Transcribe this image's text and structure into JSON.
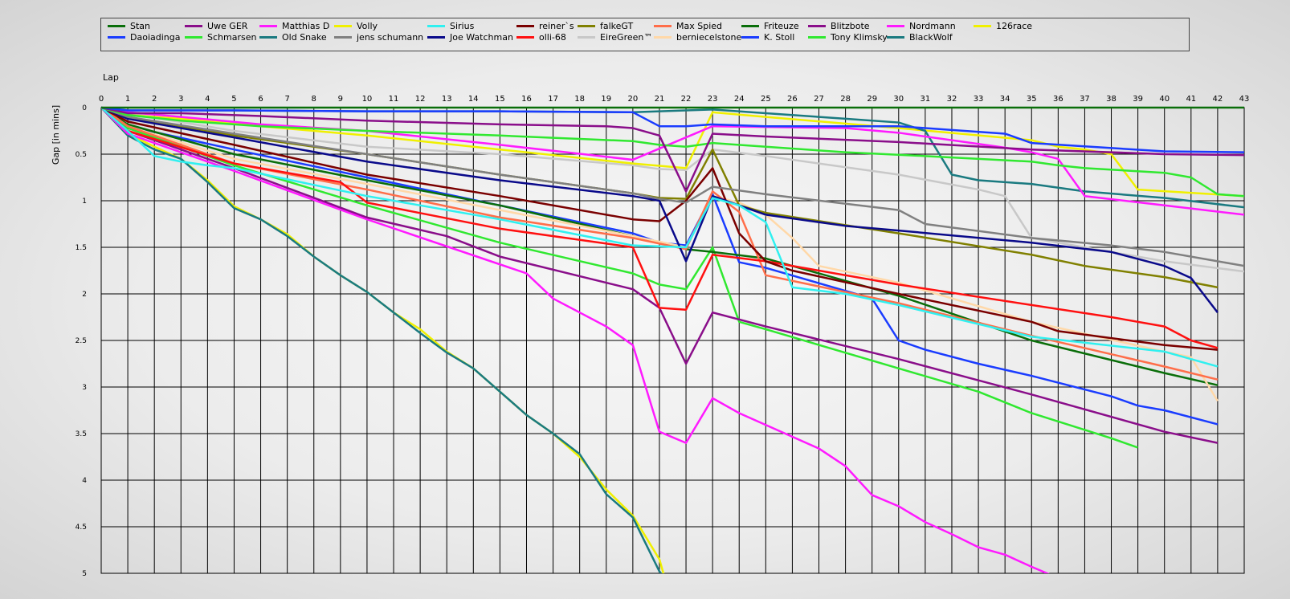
{
  "chart_data": {
    "type": "line",
    "xlabel": "Lap",
    "ylabel": "Gap [in mins]",
    "xlim": [
      0,
      43
    ],
    "ylim": [
      0,
      5
    ],
    "y_inverted": true,
    "x_ticks": [
      0,
      1,
      2,
      3,
      4,
      5,
      6,
      7,
      8,
      9,
      10,
      11,
      12,
      13,
      14,
      15,
      16,
      17,
      18,
      19,
      20,
      21,
      22,
      23,
      24,
      25,
      26,
      27,
      28,
      29,
      30,
      31,
      32,
      33,
      34,
      35,
      36,
      37,
      38,
      39,
      40,
      41,
      42,
      43
    ],
    "y_ticks": [
      "0",
      "0.5",
      "1",
      "1.5",
      "2",
      "2.5",
      "3",
      "3.5",
      "4",
      "4.5",
      "5"
    ],
    "grid": true,
    "legend_position": "top",
    "series": [
      {
        "name": "Stan",
        "color": "#0a6e0a",
        "x": [
          0,
          43
        ],
        "y": [
          0,
          0
        ]
      },
      {
        "name": "Daoiadinga",
        "color": "#1a3cff",
        "x": [
          0,
          1,
          5,
          10,
          15,
          20,
          21,
          22,
          23,
          25,
          30,
          32,
          34,
          35,
          40,
          43
        ],
        "y": [
          0,
          0.03,
          0.03,
          0.04,
          0.04,
          0.05,
          0.2,
          0.2,
          0.18,
          0.2,
          0.2,
          0.24,
          0.28,
          0.38,
          0.47,
          0.48
        ]
      },
      {
        "name": "Uwe GER",
        "color": "#8a0e8a",
        "x": [
          0,
          1,
          3,
          6,
          10,
          15,
          19,
          20,
          21,
          22,
          23,
          25,
          30,
          35,
          40,
          43
        ],
        "y": [
          0,
          0.06,
          0.06,
          0.09,
          0.14,
          0.18,
          0.2,
          0.22,
          0.3,
          0.9,
          0.28,
          0.31,
          0.37,
          0.45,
          0.5,
          0.51
        ]
      },
      {
        "name": "Schmarsen",
        "color": "#30e830",
        "x": [
          0,
          1,
          3,
          6,
          10,
          15,
          20,
          21,
          22,
          23,
          25,
          28,
          31,
          35,
          36,
          37,
          40,
          41,
          42,
          43
        ],
        "y": [
          0,
          0.08,
          0.14,
          0.2,
          0.25,
          0.3,
          0.36,
          0.4,
          0.42,
          0.38,
          0.42,
          0.48,
          0.52,
          0.58,
          0.62,
          0.65,
          0.7,
          0.75,
          0.93,
          0.95
        ]
      },
      {
        "name": "Matthias D",
        "color": "#ff1aff",
        "x": [
          0,
          1,
          3,
          6,
          10,
          15,
          20,
          23,
          28,
          30,
          34,
          35,
          36,
          37,
          40,
          43
        ],
        "y": [
          0,
          0.05,
          0.1,
          0.18,
          0.25,
          0.4,
          0.56,
          0.2,
          0.22,
          0.27,
          0.43,
          0.48,
          0.55,
          0.95,
          1.05,
          1.15
        ]
      },
      {
        "name": "Old Snake",
        "color": "#1a7a80",
        "x": [
          0,
          1,
          5,
          10,
          15,
          20,
          23,
          25,
          28,
          30,
          31,
          32,
          33,
          35,
          37,
          40,
          43
        ],
        "y": [
          0,
          0.03,
          0.03,
          0.04,
          0.04,
          0.05,
          0.02,
          0.06,
          0.12,
          0.16,
          0.25,
          0.72,
          0.78,
          0.82,
          0.9,
          0.97,
          1.07
        ]
      },
      {
        "name": "Volly",
        "color": "#f0f000",
        "x": [
          0,
          1,
          3,
          6,
          10,
          15,
          20,
          22,
          23,
          25,
          30,
          35,
          36,
          37,
          38,
          39,
          43
        ],
        "y": [
          0,
          0.08,
          0.12,
          0.2,
          0.3,
          0.45,
          0.6,
          0.65,
          0.05,
          0.1,
          0.22,
          0.35,
          0.42,
          0.45,
          0.5,
          0.88,
          0.95
        ]
      },
      {
        "name": "jens  schumann",
        "color": "#808080",
        "x": [
          0,
          1,
          5,
          10,
          15,
          20,
          21,
          22,
          23,
          25,
          30,
          31,
          35,
          38,
          40,
          42,
          43
        ],
        "y": [
          0,
          0.1,
          0.28,
          0.5,
          0.72,
          0.92,
          0.98,
          1.02,
          0.85,
          0.93,
          1.1,
          1.25,
          1.4,
          1.48,
          1.55,
          1.65,
          1.7
        ]
      },
      {
        "name": "Sirius",
        "color": "#30f0f0",
        "x": [
          0,
          1,
          2,
          3,
          4,
          5,
          10,
          15,
          20,
          22,
          23,
          24,
          25,
          26,
          28,
          30,
          35,
          40,
          42
        ],
        "y": [
          0,
          0.25,
          0.52,
          0.58,
          0.62,
          0.65,
          0.95,
          1.2,
          1.48,
          1.5,
          0.97,
          1.05,
          1.23,
          1.93,
          2.0,
          2.12,
          2.46,
          2.62,
          2.78
        ]
      },
      {
        "name": "Joe Watchman",
        "color": "#0a0a8a",
        "x": [
          0,
          1,
          5,
          10,
          15,
          20,
          21,
          22,
          23,
          25,
          28,
          30,
          35,
          38,
          40,
          41,
          42
        ],
        "y": [
          0,
          0.12,
          0.32,
          0.58,
          0.78,
          0.95,
          1.0,
          1.65,
          0.95,
          1.15,
          1.27,
          1.32,
          1.45,
          1.55,
          1.7,
          1.83,
          2.2
        ]
      },
      {
        "name": "reiner`s",
        "color": "#7a0000",
        "x": [
          0,
          1,
          5,
          10,
          15,
          20,
          21,
          22,
          23,
          24,
          25,
          26,
          30,
          35,
          36,
          40,
          42
        ],
        "y": [
          0,
          0.15,
          0.4,
          0.72,
          0.95,
          1.2,
          1.22,
          1.0,
          0.65,
          1.35,
          1.65,
          1.75,
          2.0,
          2.3,
          2.4,
          2.55,
          2.6
        ]
      },
      {
        "name": "olli-68",
        "color": "#ff1010",
        "x": [
          0,
          1,
          5,
          9,
          10,
          15,
          20,
          21,
          22,
          23,
          25,
          30,
          35,
          38,
          40,
          41,
          42
        ],
        "y": [
          0,
          0.25,
          0.6,
          0.8,
          1.02,
          1.3,
          1.5,
          2.15,
          2.17,
          1.58,
          1.65,
          1.9,
          2.12,
          2.25,
          2.35,
          2.5,
          2.58
        ]
      },
      {
        "name": "falkeGT",
        "color": "#808000",
        "x": [
          0,
          1,
          5,
          10,
          15,
          20,
          21,
          22,
          23,
          24,
          25,
          30,
          35,
          37,
          40,
          42
        ],
        "y": [
          0,
          0.1,
          0.3,
          0.5,
          0.72,
          0.92,
          0.97,
          0.98,
          0.45,
          1.05,
          1.13,
          1.35,
          1.58,
          1.7,
          1.82,
          1.93
        ]
      },
      {
        "name": "EireGreen™",
        "color": "#c8c8c8",
        "x": [
          0,
          1,
          5,
          10,
          15,
          20,
          21,
          22,
          23,
          25,
          30,
          33,
          34,
          35,
          40,
          43
        ],
        "y": [
          0,
          0.06,
          0.25,
          0.42,
          0.5,
          0.62,
          0.66,
          0.67,
          0.45,
          0.52,
          0.72,
          0.88,
          0.95,
          1.4,
          1.65,
          1.76
        ]
      },
      {
        "name": "Max Spied",
        "color": "#ff6e4a",
        "x": [
          0,
          1,
          5,
          10,
          15,
          20,
          22,
          23,
          24,
          25,
          30,
          35,
          40,
          42
        ],
        "y": [
          0,
          0.2,
          0.6,
          0.88,
          1.18,
          1.4,
          1.52,
          0.9,
          1.12,
          1.8,
          2.1,
          2.45,
          2.78,
          2.92
        ]
      },
      {
        "name": "berniecelstone",
        "color": "#ffd8a8",
        "x": [
          0,
          1,
          5,
          10,
          15,
          20,
          22,
          23,
          24,
          25,
          26,
          27,
          30,
          35,
          40,
          41,
          42
        ],
        "y": [
          0,
          0.2,
          0.55,
          0.82,
          1.1,
          1.38,
          1.5,
          0.95,
          1.02,
          1.15,
          1.4,
          1.7,
          1.88,
          2.3,
          2.62,
          2.68,
          3.15
        ]
      },
      {
        "name": "Friteuze",
        "color": "#0a6e0a",
        "x": [
          0,
          1,
          5,
          10,
          15,
          20,
          22,
          23,
          25,
          30,
          35,
          40,
          42
        ],
        "y": [
          0,
          0.18,
          0.5,
          0.78,
          1.05,
          1.38,
          1.52,
          1.55,
          1.62,
          2.02,
          2.5,
          2.85,
          2.98
        ]
      },
      {
        "name": "K. Stoll",
        "color": "#1a3cff",
        "x": [
          0,
          1,
          5,
          10,
          15,
          20,
          21,
          22,
          23,
          24,
          25,
          29,
          30,
          31,
          33,
          35,
          38,
          39,
          40,
          42
        ],
        "y": [
          0,
          0.2,
          0.45,
          0.75,
          1.05,
          1.35,
          1.45,
          1.48,
          0.93,
          1.66,
          1.72,
          2.05,
          2.5,
          2.6,
          2.75,
          2.88,
          3.1,
          3.2,
          3.25,
          3.4
        ]
      },
      {
        "name": "Blitzbote",
        "color": "#8a0e8a",
        "x": [
          0,
          1,
          5,
          10,
          13,
          15,
          20,
          21,
          22,
          23,
          25,
          30,
          35,
          40,
          42
        ],
        "y": [
          0,
          0.25,
          0.65,
          1.18,
          1.38,
          1.6,
          1.95,
          2.15,
          2.75,
          2.2,
          2.35,
          2.7,
          3.08,
          3.48,
          3.6
        ]
      },
      {
        "name": "Tony Klimsky",
        "color": "#30e830",
        "x": [
          0,
          1,
          5,
          10,
          15,
          20,
          21,
          22,
          23,
          24,
          25,
          30,
          33,
          35,
          38,
          39
        ],
        "y": [
          0,
          0.22,
          0.62,
          1.05,
          1.45,
          1.78,
          1.9,
          1.95,
          1.5,
          2.3,
          2.38,
          2.8,
          3.05,
          3.28,
          3.55,
          3.65
        ]
      },
      {
        "name": "Nordmann",
        "color": "#ff1aff",
        "x": [
          0,
          1,
          5,
          10,
          16,
          17,
          18,
          19,
          20,
          21,
          22,
          23,
          24,
          27,
          28,
          29,
          30,
          31,
          32,
          33,
          34,
          35,
          36,
          36.6
        ],
        "y": [
          0,
          0.28,
          0.68,
          1.2,
          1.78,
          2.05,
          2.2,
          2.35,
          2.55,
          3.48,
          3.6,
          3.12,
          3.28,
          3.66,
          3.85,
          4.16,
          4.28,
          4.45,
          4.58,
          4.72,
          4.8,
          4.93,
          5.05,
          5.1
        ]
      },
      {
        "name": "BlackWolf",
        "color": "#1a7a80",
        "x": [
          0,
          1,
          2,
          3,
          4,
          5,
          6,
          7,
          8,
          9,
          10,
          11,
          12,
          13,
          14,
          15,
          16,
          17,
          18,
          19,
          20,
          21,
          21.2
        ],
        "y": [
          0,
          0.3,
          0.45,
          0.55,
          0.8,
          1.08,
          1.2,
          1.38,
          1.6,
          1.8,
          1.98,
          2.2,
          2.42,
          2.63,
          2.8,
          3.05,
          3.3,
          3.5,
          3.72,
          4.15,
          4.4,
          4.98,
          5.05
        ]
      },
      {
        "name": "126race",
        "color": "#f0f000",
        "x": [
          0,
          1,
          2,
          3,
          4,
          5,
          6,
          7,
          8,
          9,
          10,
          11,
          12,
          13,
          14,
          15,
          16,
          17,
          18,
          19,
          20,
          21,
          21.2
        ],
        "y": [
          0,
          0.28,
          0.42,
          0.55,
          0.78,
          1.06,
          1.2,
          1.36,
          1.6,
          1.8,
          1.98,
          2.2,
          2.38,
          2.62,
          2.8,
          3.05,
          3.3,
          3.5,
          3.75,
          4.1,
          4.38,
          4.85,
          5.05
        ]
      }
    ]
  }
}
